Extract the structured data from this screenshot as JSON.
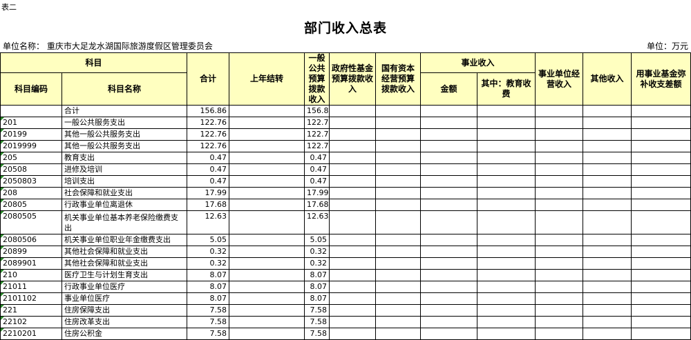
{
  "corner_label": "表二",
  "title": "部门收入总表",
  "unit_left": "单位名称：   重庆市大足龙水湖国际旅游度假区管理委员会",
  "unit_right": "单位：万元",
  "headers": {
    "kemu": "科目",
    "code": "科目编码",
    "name": "科目名称",
    "total": "合计",
    "last_year": "上年结转",
    "general": "一般公共预算拨款收入",
    "gov_fund": "政府性基金预算拨款收入",
    "state_capital": "国有资本经营预算拨款收入",
    "career": "事业收入",
    "career_amount": "金额",
    "career_edu": "其中：教育收费",
    "career_unit": "事业单位经营收入",
    "other": "其他收入",
    "fund_make_up": "用事业基金弥补收支差额"
  },
  "rows": [
    {
      "code": "",
      "name": "合计",
      "total": "156.86",
      "general": "156.86"
    },
    {
      "code": "201",
      "name": "一般公共服务支出",
      "total": "122.76",
      "general": "122.76"
    },
    {
      "code": "20199",
      "name": "其他一般公共服务支出",
      "total": "122.76",
      "general": "122.76"
    },
    {
      "code": "2019999",
      "name": "其他一般公共服务支出",
      "total": "122.76",
      "general": "122.76"
    },
    {
      "code": "205",
      "name": "教育支出",
      "total": "0.47",
      "general": "0.47"
    },
    {
      "code": "20508",
      "name": "进修及培训",
      "total": "0.47",
      "general": "0.47"
    },
    {
      "code": "2050803",
      "name": "培训支出",
      "total": "0.47",
      "general": "0.47"
    },
    {
      "code": "208",
      "name": "社会保障和就业支出",
      "total": "17.99",
      "general": "17.99"
    },
    {
      "code": "20805",
      "name": "行政事业单位离退休",
      "total": "17.68",
      "general": "17.68"
    },
    {
      "code": "2080505",
      "name": "机关事业单位基本养老保险缴费支出",
      "total": "12.63",
      "general": "12.63",
      "tall": true
    },
    {
      "code": "2080506",
      "name": "机关事业单位职业年金缴费支出",
      "total": "5.05",
      "general": "5.05"
    },
    {
      "code": "20899",
      "name": "其他社会保障和就业支出",
      "total": "0.32",
      "general": "0.32"
    },
    {
      "code": "2089901",
      "name": "其他社会保障和就业支出",
      "total": "0.32",
      "general": "0.32"
    },
    {
      "code": "210",
      "name": "医疗卫生与计划生育支出",
      "total": "8.07",
      "general": "8.07"
    },
    {
      "code": "21011",
      "name": "行政事业单位医疗",
      "total": "8.07",
      "general": "8.07"
    },
    {
      "code": "2101102",
      "name": "事业单位医疗",
      "total": "8.07",
      "general": "8.07"
    },
    {
      "code": "221",
      "name": "住房保障支出",
      "total": "7.58",
      "general": "7.58"
    },
    {
      "code": "22102",
      "name": "住房改革支出",
      "total": "7.58",
      "general": "7.58"
    },
    {
      "code": "2210201",
      "name": "住房公积金",
      "total": "7.58",
      "general": "7.58"
    }
  ]
}
